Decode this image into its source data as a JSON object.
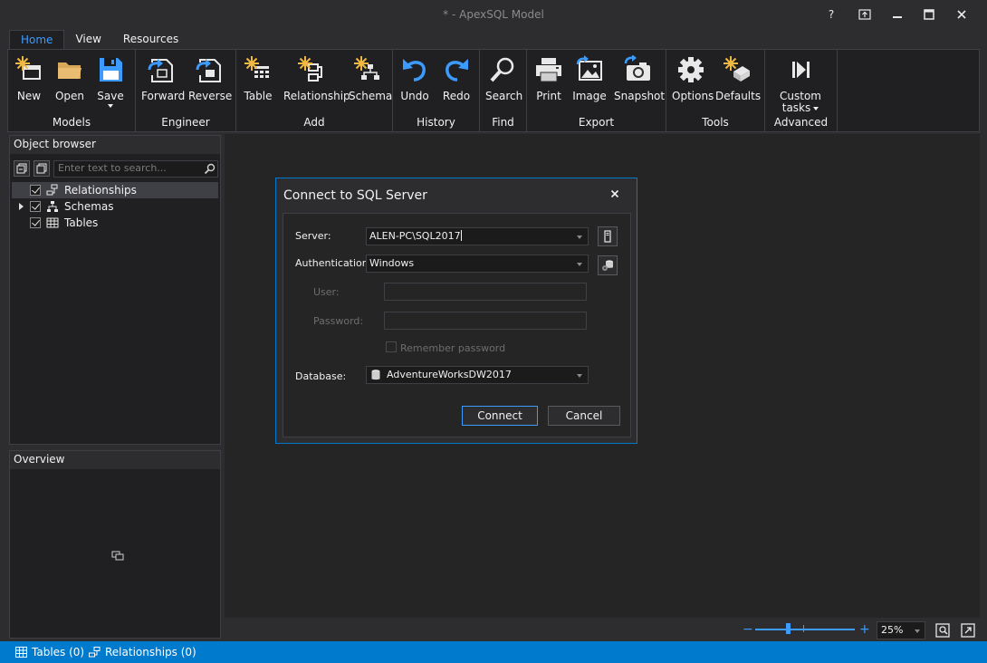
{
  "window": {
    "title": "* - ApexSQL Model",
    "help_label": "?",
    "controls": {
      "minimize": "—",
      "maximize": "☐",
      "close": "✕"
    }
  },
  "ribbon": {
    "tabs": [
      {
        "label": "Home",
        "active": true
      },
      {
        "label": "View"
      },
      {
        "label": "Resources"
      }
    ],
    "groups": {
      "models": {
        "label": "Models",
        "new": "New",
        "open": "Open",
        "save": "Save"
      },
      "engineer": {
        "label": "Engineer",
        "forward": "Forward",
        "reverse": "Reverse"
      },
      "add": {
        "label": "Add",
        "table": "Table",
        "relationship": "Relationship",
        "schema": "Schema"
      },
      "history": {
        "label": "History",
        "undo": "Undo",
        "redo": "Redo"
      },
      "find": {
        "label": "Find",
        "search": "Search"
      },
      "export": {
        "label": "Export",
        "print": "Print",
        "image": "Image",
        "snapshot": "Snapshot"
      },
      "tools": {
        "label": "Tools",
        "options": "Options",
        "defaults": "Defaults"
      },
      "advanced": {
        "label": "Advanced",
        "custom_line1": "Custom",
        "custom_line2": "tasks"
      }
    }
  },
  "object_browser": {
    "title": "Object browser",
    "search_placeholder": "Enter text to search...",
    "items": [
      {
        "label": "Relationships",
        "checked": true,
        "selected": true,
        "icon": "relationship-icon"
      },
      {
        "label": "Schemas",
        "checked": true,
        "expandable": true,
        "icon": "schema-icon"
      },
      {
        "label": "Tables",
        "checked": true,
        "icon": "table-icon"
      }
    ]
  },
  "overview": {
    "title": "Overview"
  },
  "dialog": {
    "title": "Connect to SQL Server",
    "server_label": "Server:",
    "server_value": "ALEN-PC\\SQL2017",
    "auth_label": "Authentication:",
    "auth_value": "Windows",
    "user_label": "User:",
    "password_label": "Password:",
    "remember_label": "Remember password",
    "database_label": "Database:",
    "database_value": "AdventureWorksDW2017",
    "connect_label": "Connect",
    "cancel_label": "Cancel"
  },
  "zoom": {
    "value": "25%",
    "minus": "−",
    "plus": "+",
    "level_percent": 25
  },
  "status": {
    "tables": "Tables (0)",
    "relationships": "Relationships (0)"
  },
  "colors": {
    "accent": "#007acc",
    "highlight": "#3c9bff",
    "background": "#2d2d30"
  }
}
